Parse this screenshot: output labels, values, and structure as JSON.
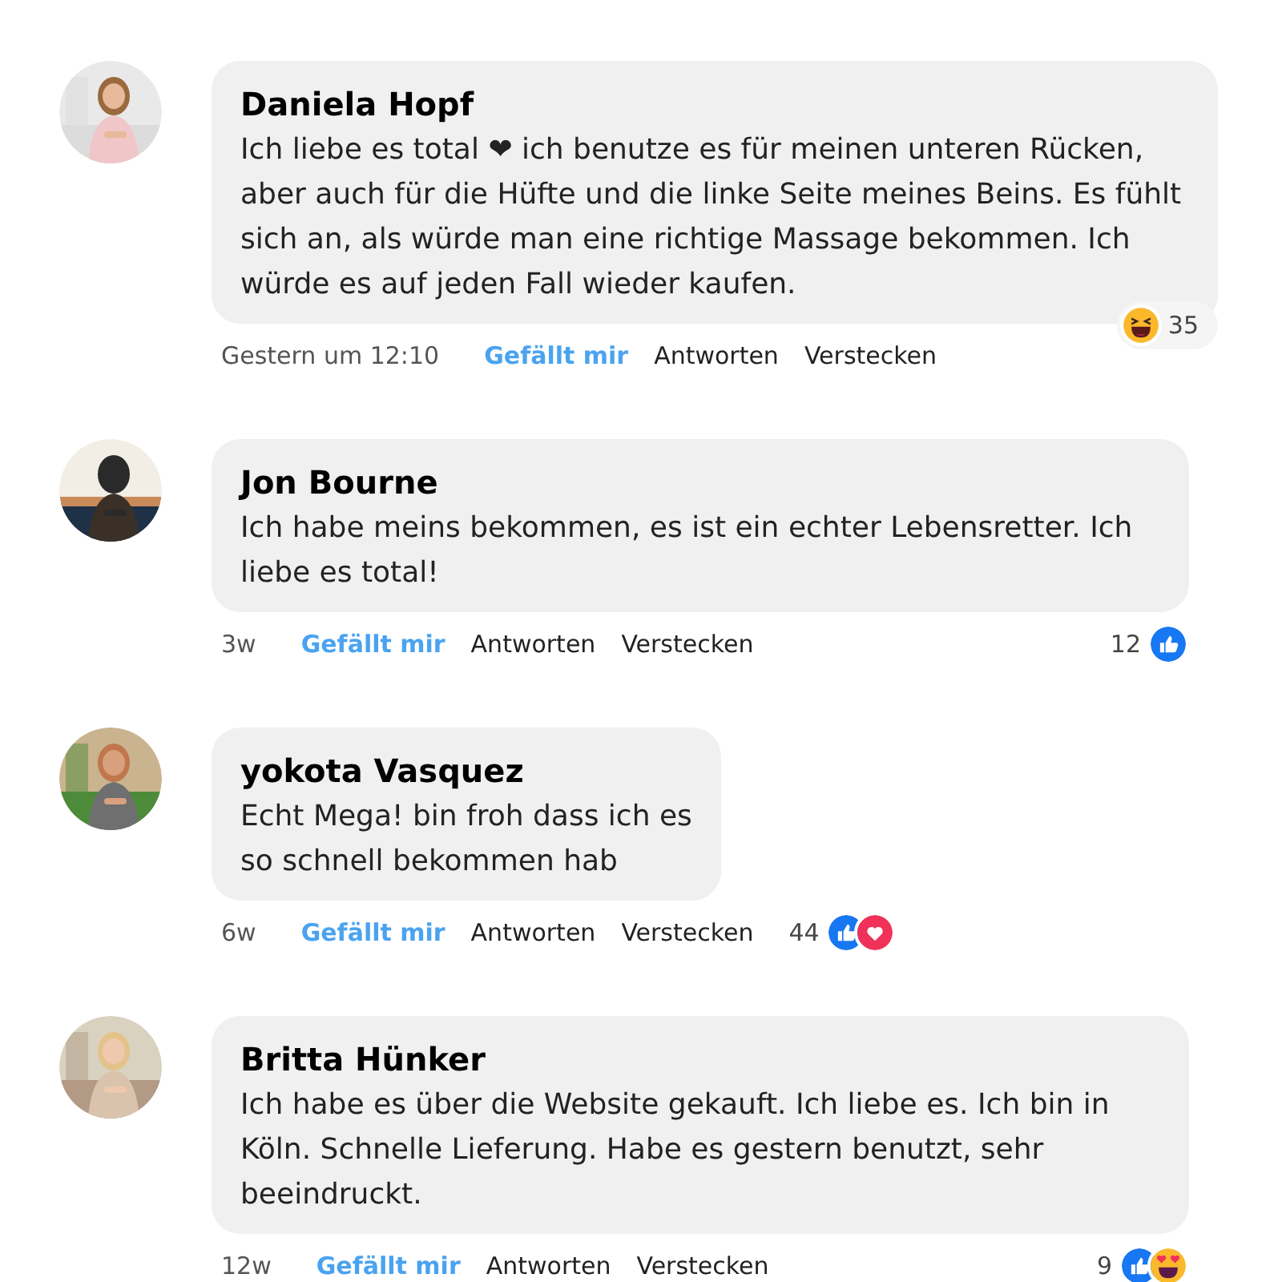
{
  "comments": [
    {
      "author": "Daniela Hopf",
      "text": "Ich liebe es total ❤ ich benutze es für meinen unteren Rücken, aber auch für die Hüfte und die linke Seite meines Beins. Es fühlt sich an, als würde man eine richtige Massage bekommen. Ich würde es auf jeden Fall wieder kaufen.",
      "time": "Gestern um 12:10",
      "like": "Gefällt mir",
      "reply": "Antworten",
      "hide": "Verstecken",
      "reactions": {
        "kind": "pill",
        "count": "35",
        "icons": [
          {
            "kind": "laugh"
          }
        ]
      }
    },
    {
      "author": "Jon Bourne",
      "text": "Ich habe meins bekommen, es ist ein echter Lebensretter. Ich liebe es total!",
      "time": "3w",
      "like": "Gefällt mir",
      "reply": "Antworten",
      "hide": "Verstecken",
      "reactions": {
        "kind": "right",
        "count": "12",
        "icons": [
          {
            "kind": "like"
          }
        ]
      }
    },
    {
      "author": "yokota Vasquez",
      "text": "Echt Mega! bin froh dass ich es\n so schnell bekommen hab",
      "time": "6w",
      "like": "Gefällt mir",
      "reply": "Antworten",
      "hide": "Verstecken",
      "reactions": {
        "kind": "inline",
        "count": "44",
        "icons": [
          {
            "kind": "like"
          },
          {
            "kind": "love"
          }
        ]
      }
    },
    {
      "author": "Britta Hünker",
      "text": "Ich habe es über die Website gekauft. Ich liebe es. Ich bin in Köln. Schnelle Lieferung. Habe es gestern benutzt, sehr beeindruckt.",
      "time": "12w",
      "like": "Gefällt mir",
      "reply": "Antworten",
      "hide": "Verstecken",
      "reactions": {
        "kind": "right",
        "count": "9",
        "icons": [
          {
            "kind": "like"
          },
          {
            "kind": "heart-eyes"
          }
        ]
      }
    }
  ]
}
